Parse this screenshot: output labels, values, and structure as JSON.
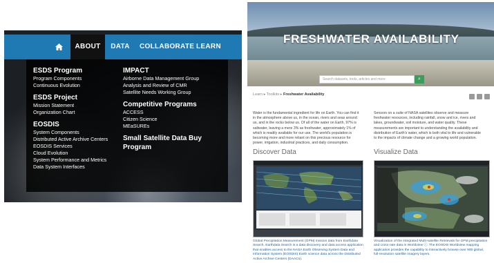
{
  "left_panel": {
    "nav": {
      "home_icon": "home-icon",
      "items": [
        "ABOUT",
        "DATA",
        "COLLABORATE",
        "LEARN"
      ]
    },
    "col1": [
      {
        "heading": "ESDS Program",
        "items": [
          "Program Components",
          "Continuous Evolution"
        ]
      },
      {
        "heading": "ESDS Project",
        "items": [
          "Mission Statement",
          "Organization Chart"
        ]
      },
      {
        "heading": "EOSDIS",
        "items": [
          "System Components",
          "Distributed Active Archive Centers",
          "EOSDIS Services",
          "Cloud Evolution",
          "System Performance and Metrics",
          "Data System Interfaces"
        ]
      }
    ],
    "col2": [
      {
        "heading": "IMPACT",
        "items": [
          "Airborne Data Management Group",
          "Analysis and Review of CMR",
          "Satellite Needs Working Group"
        ]
      },
      {
        "heading": "Competitive Programs",
        "items": [
          "ACCESS",
          "Citizen Science",
          "MEaSUREs"
        ]
      },
      {
        "heading": "Small Satellite Data Buy Program",
        "items": []
      }
    ]
  },
  "right_panel": {
    "hero_title": "FRESHWATER AVAILABILITY",
    "search_placeholder": "Search datasets, tools, articles and more",
    "breadcrumb": {
      "a": "Learn",
      "b": "Toolkits",
      "c": "Freshwater Availability"
    },
    "intro_left": "Water is the fundamental ingredient for life on Earth. You can find it in the atmosphere above us, in the ocean, rivers and seas around us, and in the rocks below us. Of all of the water on Earth, 97% is saltwater, leaving a mere 3% as freshwater, approximately 1% of which is readily available for our use. The world's population is becoming more and more reliant on this precious resource for power, irrigation, industrial practices, and daily consumption.",
    "intro_right": "Sensors on a suite of NASA satellites observe and measure freshwater resources, including rainfall, snow and ice, rivers and lakes, groundwater, soil moisture, and water quality. These measurements are important to understanding the availability and distribution of Earth's water, which is both vital to life and vulnerable to the impacts of climate change and a growing world population.",
    "discover_title": "Discover Data",
    "visualize_title": "Visualize Data",
    "caption_left": "Global Precipitation Measurement (GPM) mission data from Earthdata Search. Earthdata Search is a data discovery and data access application that enables access to the NASA Earth Observing System Data and Information System (EOSDIS) Earth science data across the Distributed Active Archive Centers (DAACs).",
    "caption_right": "Visualization of the integrated Multi-satellite Retrievals for GPM precipitation and cross-rate data in Worldview ⓘ. The EOSDIS Worldview mapping application provides the capability to interactively browse over 900 global, full-resolution satellite imagery layers."
  }
}
